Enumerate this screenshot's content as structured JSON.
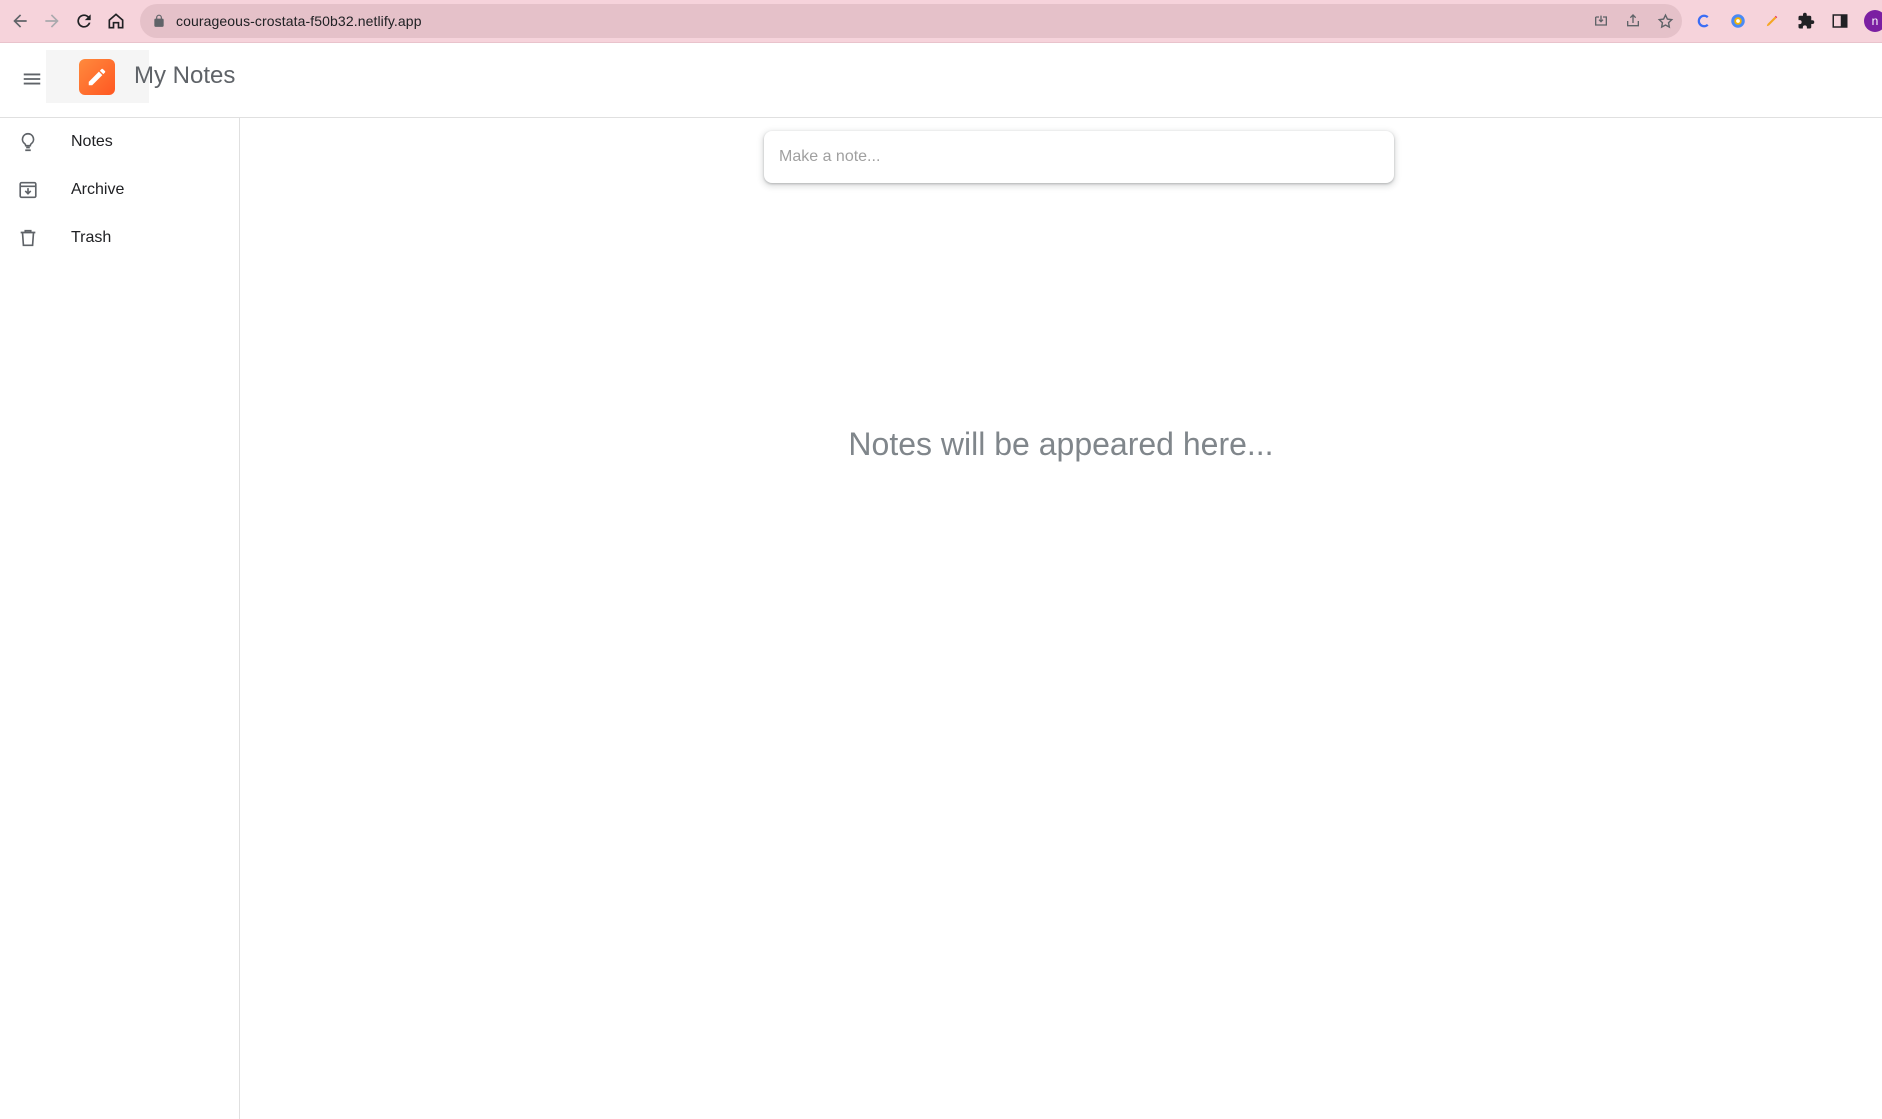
{
  "browser": {
    "url": "courageous-crostata-f50b32.netlify.app",
    "profile_initial": "n"
  },
  "header": {
    "title": "My Notes"
  },
  "sidebar": {
    "items": [
      {
        "label": "Notes",
        "icon": "lightbulb-icon"
      },
      {
        "label": "Archive",
        "icon": "archive-icon"
      },
      {
        "label": "Trash",
        "icon": "trash-icon"
      }
    ]
  },
  "main": {
    "note_placeholder": "Make a note...",
    "empty_message": "Notes will be appeared here..."
  },
  "colors": {
    "browser_bar": "#f6d3db",
    "logo_accent": "#ff5722",
    "muted_text": "#80868b"
  }
}
